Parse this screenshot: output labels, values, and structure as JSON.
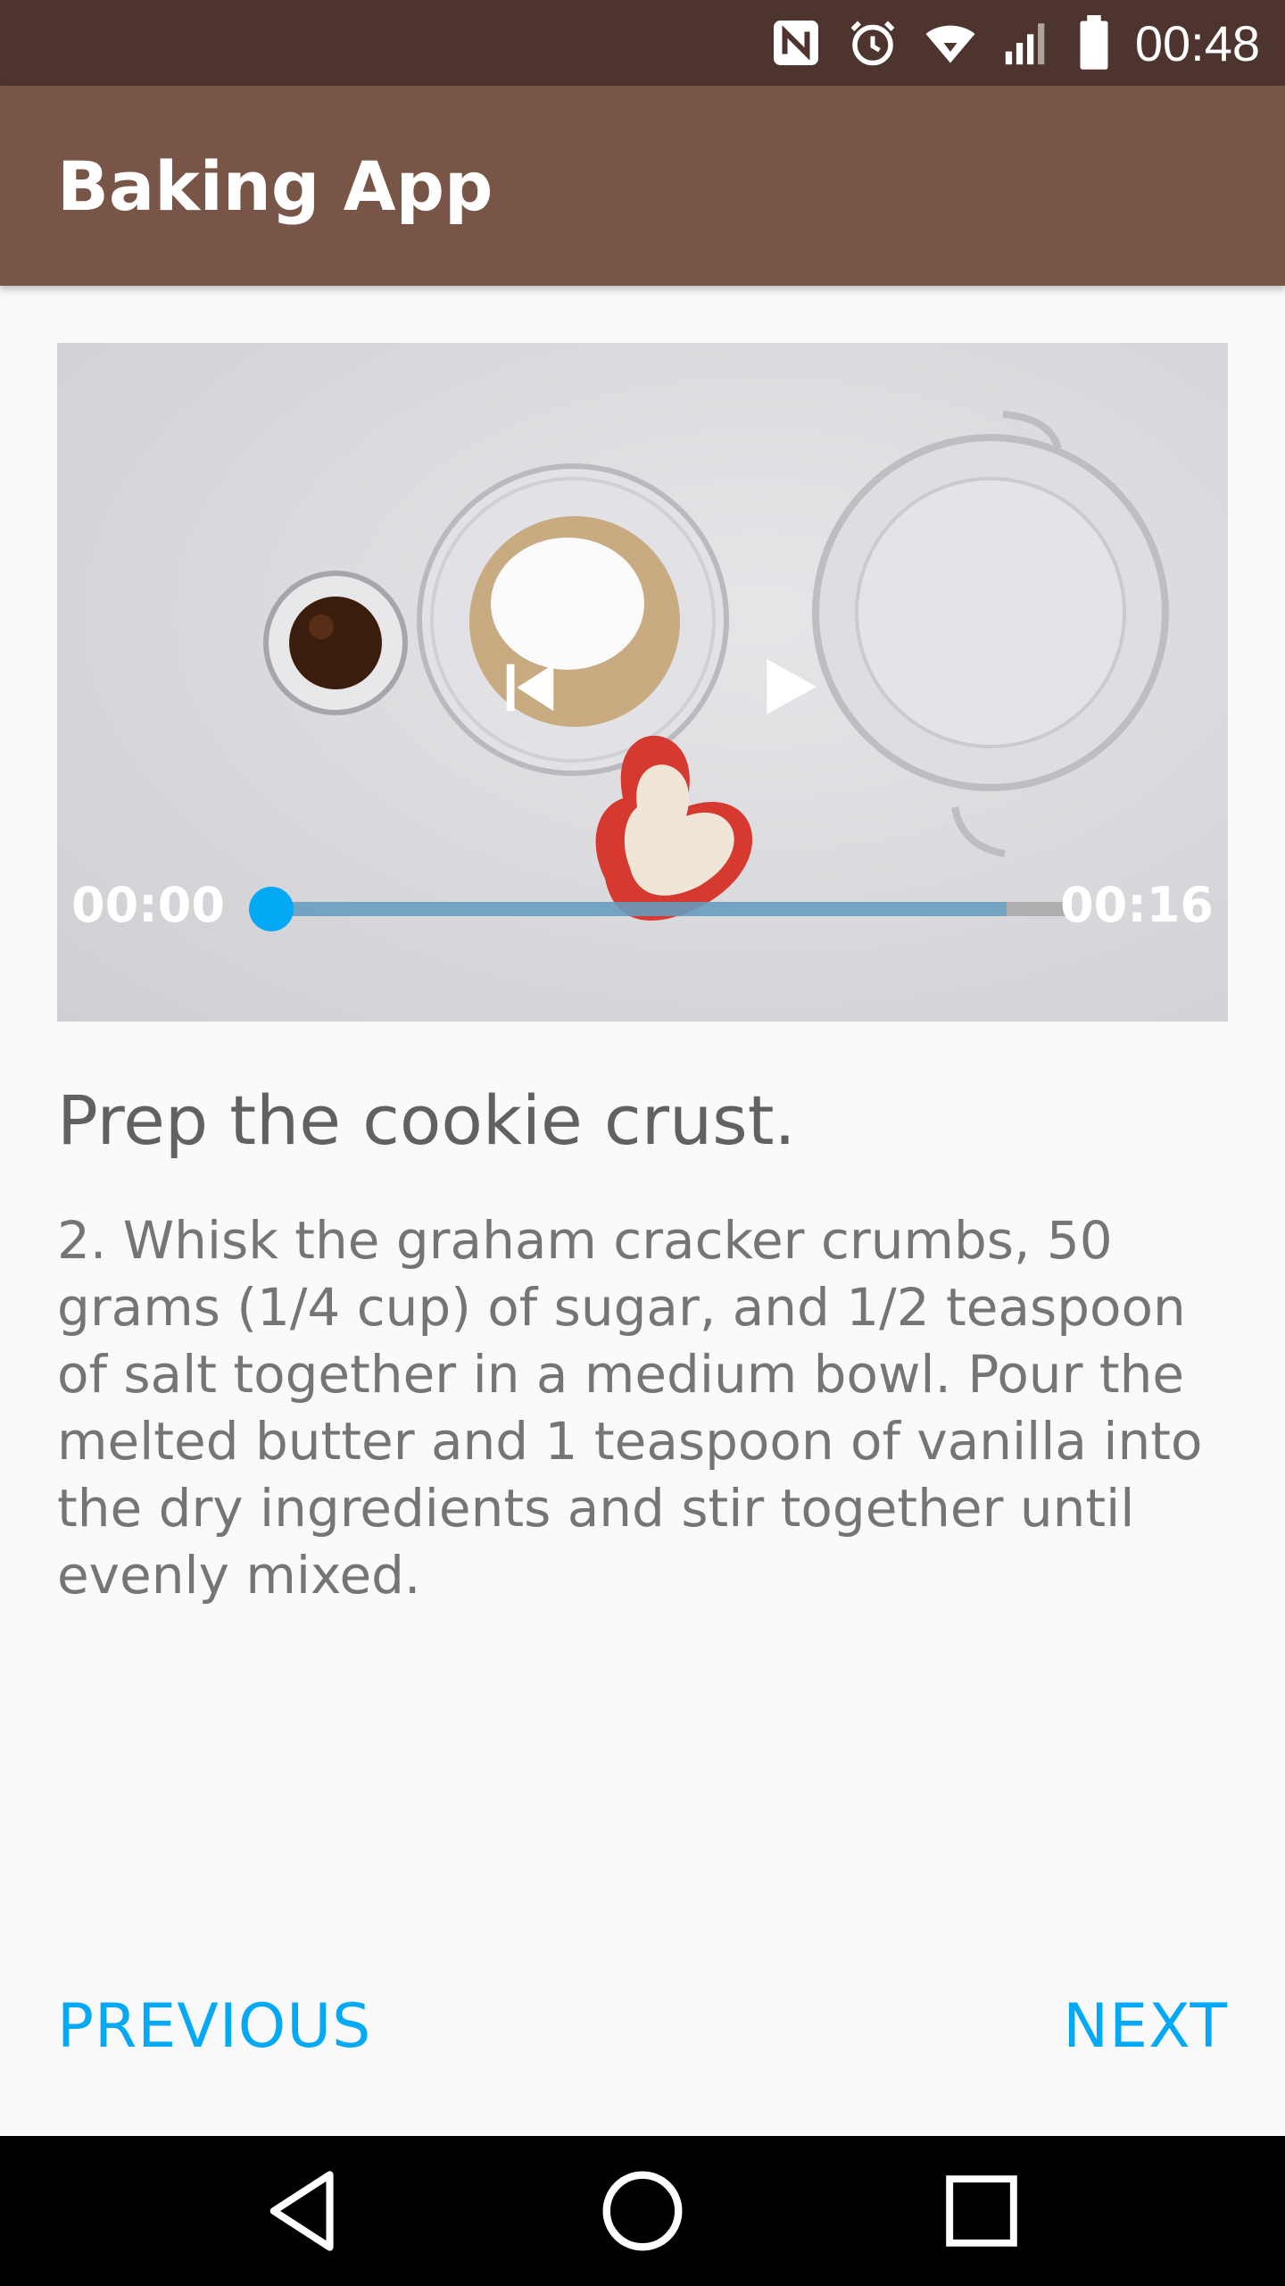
{
  "status_bar": {
    "time": "00:48",
    "icons": [
      "nfc-icon",
      "alarm-icon",
      "wifi-icon",
      "signal-icon",
      "battery-icon"
    ]
  },
  "app_bar": {
    "title": "Baking App",
    "color": "#795548"
  },
  "video_player": {
    "position": "00:00",
    "duration": "00:16",
    "progress_fraction": 0.0,
    "buffered_fraction": 0.92,
    "accent": "#03a9f4",
    "controls": [
      "previous-track-icon",
      "play-icon"
    ]
  },
  "step": {
    "title": "Prep the cookie crust.",
    "description": "2. Whisk the graham cracker crumbs, 50 grams (1/4 cup) of sugar, and 1/2 teaspoon of salt together in a medium bowl. Pour the melted butter and 1 teaspoon of vanilla into the dry ingredients and stir together until evenly mixed."
  },
  "navigation": {
    "previous_label": "PREVIOUS",
    "next_label": "NEXT"
  },
  "system_nav": [
    "back-icon",
    "home-icon",
    "recents-icon"
  ]
}
